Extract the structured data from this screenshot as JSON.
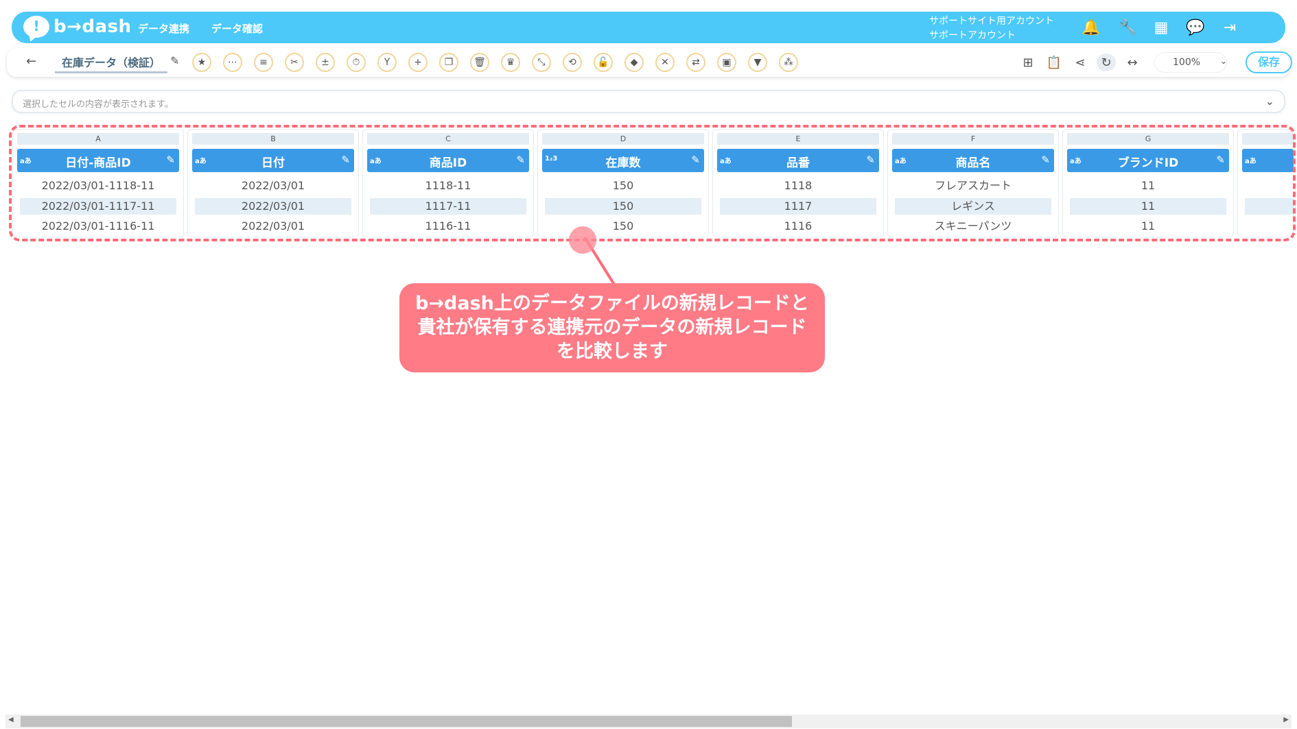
{
  "header": {
    "logo_text": "b→dash",
    "nav": [
      "データ連携",
      "データ確認"
    ],
    "account_line1": "サポートサイト用アカウント",
    "account_line2": "サポートアカウント",
    "icons": [
      "bell-icon",
      "wrench-icon",
      "grid-icon",
      "chat-icon",
      "logout-icon"
    ]
  },
  "toolbar": {
    "back_icon": "←",
    "file_name": "在庫データ（検証）",
    "edit_icon": "pencil-icon",
    "tool_icons": [
      "star-icon",
      "more-icon",
      "list-icon",
      "cut-icon",
      "calc-icon",
      "timer-icon",
      "merge-icon",
      "add-icon",
      "copy-icon",
      "delete-icon",
      "crown-icon",
      "expand-icon",
      "repeat-icon",
      "lock-icon",
      "stack-icon",
      "close-circle-icon",
      "convert-icon",
      "frame-icon",
      "filter-icon",
      "pattern-icon"
    ],
    "right_icons": [
      "flow-icon",
      "clipboard-icon",
      "share-icon",
      "refresh-icon",
      "code-icon"
    ],
    "zoom": "100%",
    "save_label": "保存"
  },
  "cellbar": {
    "placeholder": "選択したセルの内容が表示されます。"
  },
  "grid": {
    "columns": [
      {
        "letter": "A",
        "type": "aあ",
        "name": "日付-商品ID",
        "cells": [
          "2022/03/01-1118-11",
          "2022/03/01-1117-11",
          "2022/03/01-1116-11"
        ]
      },
      {
        "letter": "B",
        "type": "aあ",
        "name": "日付",
        "cells": [
          "2022/03/01",
          "2022/03/01",
          "2022/03/01"
        ]
      },
      {
        "letter": "C",
        "type": "aあ",
        "name": "商品ID",
        "cells": [
          "1118-11",
          "1117-11",
          "1116-11"
        ]
      },
      {
        "letter": "D",
        "type": "1₂3",
        "name": "在庫数",
        "cells": [
          "150",
          "150",
          "150"
        ]
      },
      {
        "letter": "E",
        "type": "aあ",
        "name": "品番",
        "cells": [
          "1118",
          "1117",
          "1116"
        ]
      },
      {
        "letter": "F",
        "type": "aあ",
        "name": "商品名",
        "cells": [
          "フレアスカート",
          "レギンス",
          "スキニーパンツ"
        ]
      },
      {
        "letter": "G",
        "type": "aあ",
        "name": "ブランドID",
        "cells": [
          "11",
          "11",
          "11"
        ]
      },
      {
        "letter": "",
        "type": "aあ",
        "name": "",
        "cells": [
          "",
          "",
          ""
        ]
      }
    ]
  },
  "callout": {
    "line1": "b→dash上のデータファイルの新規レコードと",
    "line2": "貴社が保有する連携元のデータの新規レコード",
    "line3": "を比較します"
  },
  "colors": {
    "header": "#4cc9f8",
    "column_header": "#3a9ae6",
    "highlight": "#ff6b7a",
    "callout": "#ff7b86"
  }
}
